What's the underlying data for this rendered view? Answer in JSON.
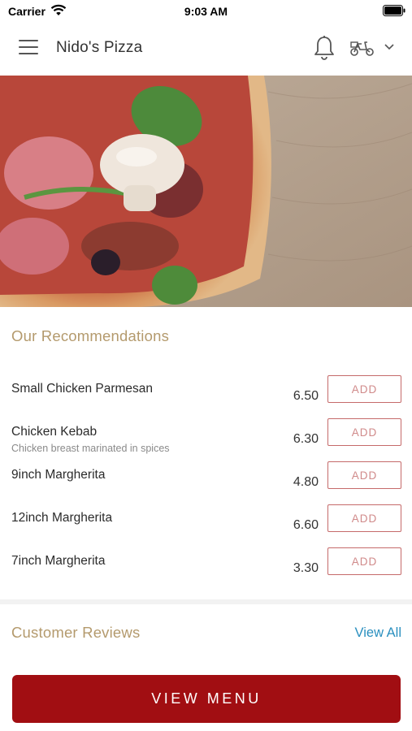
{
  "status_bar": {
    "carrier": "Carrier",
    "time": "9:03 AM"
  },
  "nav": {
    "title": "Nido's Pizza",
    "icons": [
      "menu-icon",
      "bell-icon",
      "delivery-scooter-icon",
      "chevron-down-icon"
    ]
  },
  "recommendations": {
    "title": "Our Recommendations",
    "items": [
      {
        "name": "Small Chicken Parmesan",
        "description": "",
        "price": "6.50",
        "add_label": "ADD"
      },
      {
        "name": "Chicken Kebab",
        "description": "Chicken breast marinated in spices",
        "price": "6.30",
        "add_label": "ADD"
      },
      {
        "name": "9inch Margherita",
        "description": "",
        "price": "4.80",
        "add_label": "ADD"
      },
      {
        "name": "12inch Margherita",
        "description": "",
        "price": "6.60",
        "add_label": "ADD"
      },
      {
        "name": "7inch Margherita",
        "description": "",
        "price": "3.30",
        "add_label": "ADD"
      }
    ]
  },
  "reviews": {
    "title": "Customer Reviews",
    "view_all_label": "View All"
  },
  "footer": {
    "view_menu_label": "VIEW MENU"
  },
  "colors": {
    "accent_red": "#a10e12",
    "add_border": "#c56a6a",
    "section_gold": "#b49a6d",
    "link_blue": "#2a8fbf"
  }
}
